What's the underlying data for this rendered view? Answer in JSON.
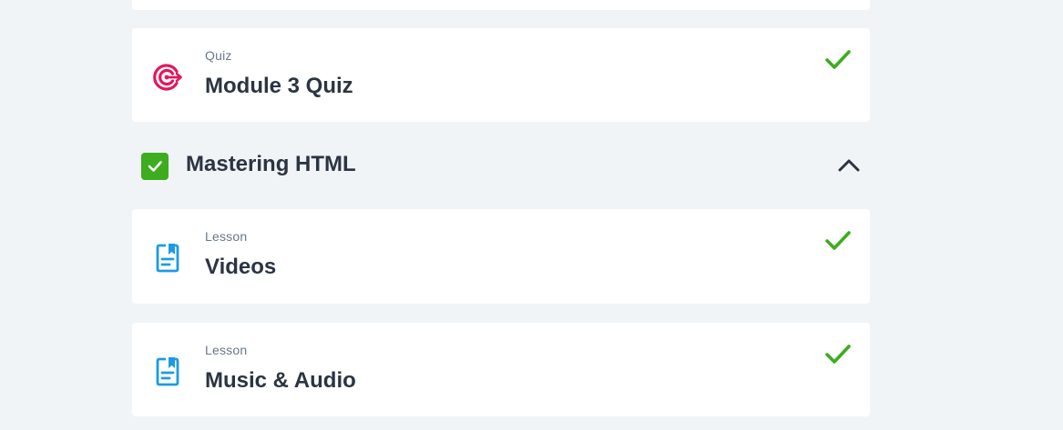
{
  "items": [
    {
      "type": "Quiz",
      "title": "Module 3 Quiz",
      "icon": "target-icon",
      "completed": true
    },
    {
      "type": "Lesson",
      "title": "Videos",
      "icon": "document-icon",
      "completed": true
    },
    {
      "type": "Lesson",
      "title": "Music & Audio",
      "icon": "document-icon",
      "completed": true
    }
  ],
  "section": {
    "title": "Mastering HTML",
    "completed": true,
    "expanded": true
  },
  "colors": {
    "background": "#f1f4f7",
    "card": "#ffffff",
    "check_green": "#3dac1e",
    "quiz_icon": "#e2185b",
    "lesson_icon": "#1d9be2",
    "text": "#2b3442",
    "muted": "#6b7787"
  }
}
